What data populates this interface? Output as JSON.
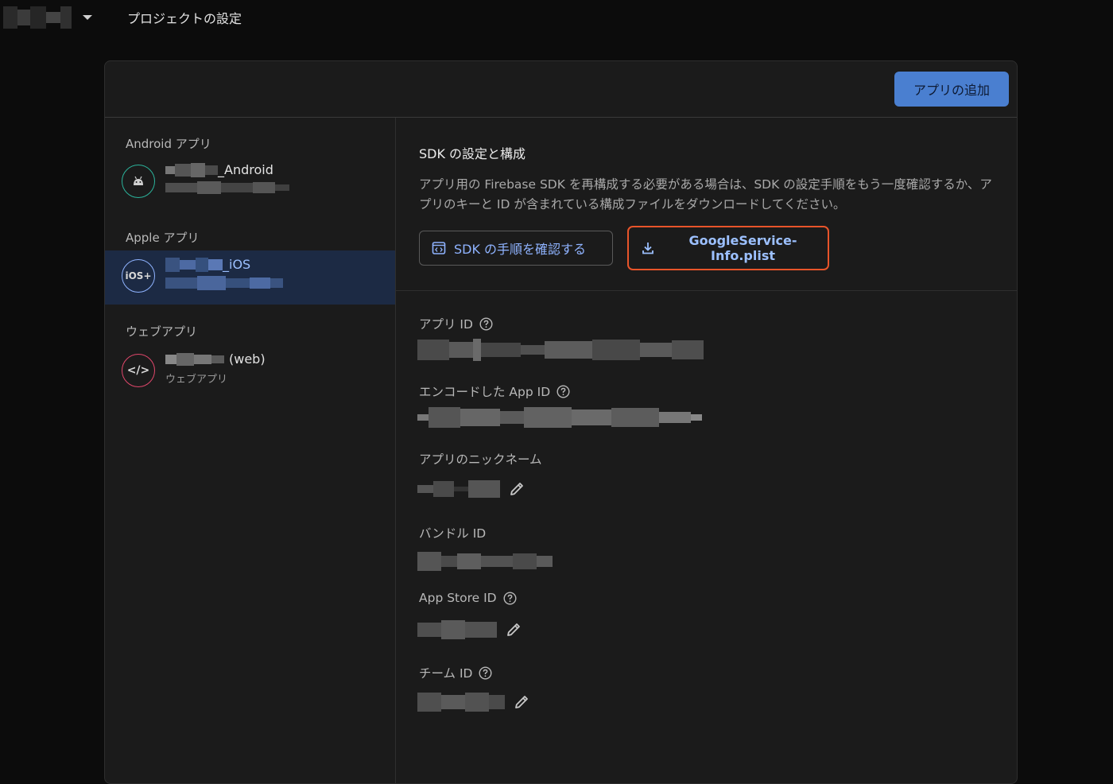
{
  "header": {
    "page_title": "プロジェクトの設定"
  },
  "card": {
    "add_app_label": "アプリの追加"
  },
  "sidebar": {
    "groups": [
      {
        "label": "Android アプリ",
        "app": {
          "name_suffix": "_Android",
          "icon": "android-icon",
          "accent": "#2bb39b"
        }
      },
      {
        "label": "Apple アプリ",
        "app": {
          "name_suffix": "_iOS",
          "icon": "ios-icon",
          "icon_text": "iOS+",
          "accent": "#8fb3ff"
        }
      },
      {
        "label": "ウェブアプリ",
        "app": {
          "name_suffix": "(web)",
          "subtitle": "ウェブアプリ",
          "icon": "code-icon",
          "icon_text": "</>",
          "accent": "#e0476b"
        }
      }
    ]
  },
  "sdk": {
    "title": "SDK の設定と構成",
    "description": "アプリ用の Firebase SDK を再構成する必要がある場合は、SDK の設定手順をもう一度確認するか、アプリのキーと ID が含まれている構成ファイルをダウンロードしてください。",
    "steps_button": "SDK の手順を確認する",
    "download_button": "GoogleService-Info.plist"
  },
  "fields": {
    "app_id": "アプリ ID",
    "encoded_app_id": "エンコードした App ID",
    "nickname": "アプリのニックネーム",
    "bundle_id": "バンドル ID",
    "app_store_id": "App Store ID",
    "team_id": "チーム ID"
  },
  "colors": {
    "accent_blue": "#4a7fd0",
    "highlight_orange": "#e8542a",
    "selected_bg": "#1c2a44"
  }
}
